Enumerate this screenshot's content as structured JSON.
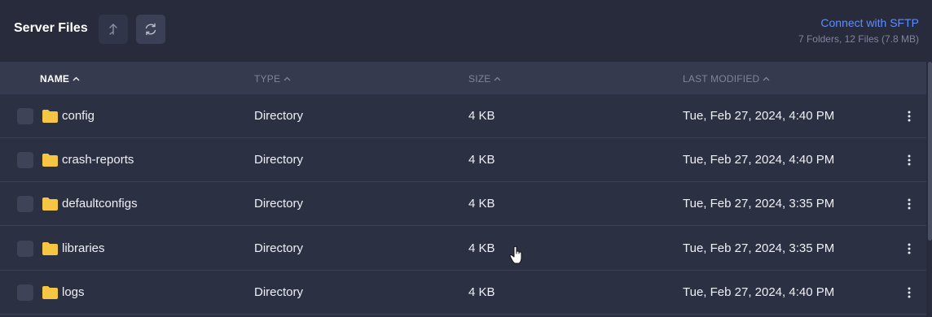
{
  "header": {
    "title": "Server Files",
    "sftp_link": "Connect with SFTP",
    "summary": "7 Folders, 12 Files (7.8 MB)"
  },
  "table": {
    "columns": {
      "name": "NAME",
      "type": "TYPE",
      "size": "SIZE",
      "modified": "LAST MODIFIED"
    },
    "rows": [
      {
        "name": "config",
        "type": "Directory",
        "size": "4 KB",
        "modified": "Tue, Feb 27, 2024, 4:40 PM"
      },
      {
        "name": "crash-reports",
        "type": "Directory",
        "size": "4 KB",
        "modified": "Tue, Feb 27, 2024, 4:40 PM"
      },
      {
        "name": "defaultconfigs",
        "type": "Directory",
        "size": "4 KB",
        "modified": "Tue, Feb 27, 2024, 3:35 PM"
      },
      {
        "name": "libraries",
        "type": "Directory",
        "size": "4 KB",
        "modified": "Tue, Feb 27, 2024, 3:35 PM"
      },
      {
        "name": "logs",
        "type": "Directory",
        "size": "4 KB",
        "modified": "Tue, Feb 27, 2024, 4:40 PM"
      }
    ]
  },
  "colors": {
    "accent": "#5f8dff",
    "folder": "#f6c544",
    "background": "#272b3c"
  },
  "icons": [
    "upload-icon",
    "refresh-icon",
    "folder-icon",
    "kebab-menu-icon",
    "chevron-up-icon",
    "hand-cursor-icon"
  ]
}
